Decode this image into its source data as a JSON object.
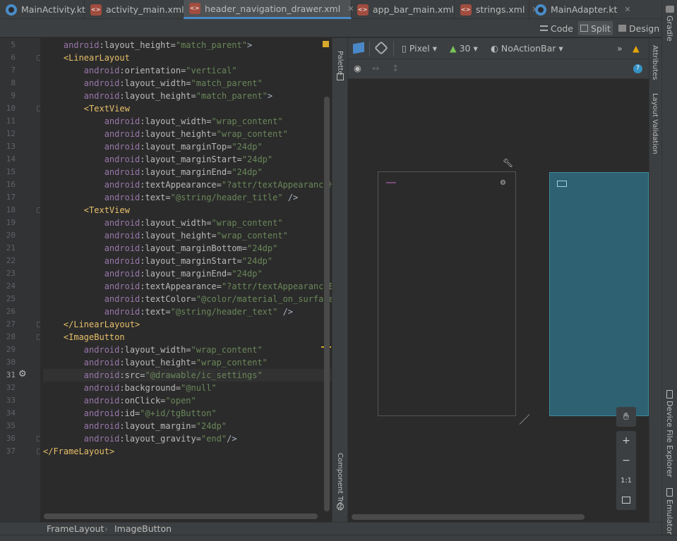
{
  "tabs": [
    {
      "label": "MainActivity.kt",
      "icon": "kotlin-file-icon"
    },
    {
      "label": "activity_main.xml",
      "icon": "xml-file-icon"
    },
    {
      "label": "header_navigation_drawer.xml",
      "icon": "xml-file-icon"
    },
    {
      "label": "app_bar_main.xml",
      "icon": "xml-file-icon"
    },
    {
      "label": "strings.xml",
      "icon": "xml-file-icon"
    },
    {
      "label": "MainAdapter.kt",
      "icon": "kotlin-file-icon"
    }
  ],
  "view_modes": {
    "code": "Code",
    "split": "Split",
    "design": "Design"
  },
  "right_tools": {
    "gradle": "Gradle",
    "device_file_explorer": "Device File Explorer",
    "emulator": "Emulator"
  },
  "side_panels": {
    "palette": "Palette",
    "component_tree": "Component Tree",
    "attributes": "Attributes",
    "layout_validation": "Layout Validation"
  },
  "design_toolbar": {
    "device": "Pixel",
    "api": "30",
    "theme": "NoActionBar"
  },
  "zoom": {
    "plus": "+",
    "minus": "−",
    "one_to_one": "1:1"
  },
  "breadcrumb": [
    "FrameLayout",
    "ImageButton"
  ],
  "code_lines": [
    {
      "n": "5",
      "t": [
        [
          "    ",
          ""
        ],
        [
          "android",
          ""
        ],
        [
          ":layout_height=",
          ""
        ],
        [
          "\"match_parent\"",
          ""
        ],
        [
          ">",
          ""
        ]
      ]
    },
    {
      "n": "6",
      "t": []
    },
    {
      "n": "7",
      "t": []
    },
    {
      "n": "8",
      "t": []
    },
    {
      "n": "9",
      "t": []
    },
    {
      "n": "10",
      "t": []
    },
    {
      "n": "11",
      "t": []
    },
    {
      "n": "12",
      "t": []
    },
    {
      "n": "13",
      "t": []
    },
    {
      "n": "14",
      "t": []
    },
    {
      "n": "15",
      "t": []
    },
    {
      "n": "16",
      "t": []
    },
    {
      "n": "17",
      "t": []
    },
    {
      "n": "18",
      "t": []
    },
    {
      "n": "19",
      "t": []
    },
    {
      "n": "20",
      "t": []
    },
    {
      "n": "21",
      "t": []
    },
    {
      "n": "22",
      "t": []
    },
    {
      "n": "23",
      "t": []
    },
    {
      "n": "24",
      "t": []
    },
    {
      "n": "25",
      "t": []
    },
    {
      "n": "26",
      "t": []
    },
    {
      "n": "27",
      "t": []
    },
    {
      "n": "28",
      "t": []
    },
    {
      "n": "29",
      "t": []
    },
    {
      "n": "30",
      "t": []
    },
    {
      "n": "31",
      "t": []
    },
    {
      "n": "32",
      "t": []
    },
    {
      "n": "33",
      "t": []
    },
    {
      "n": "34",
      "t": []
    },
    {
      "n": "35",
      "t": []
    },
    {
      "n": "36",
      "t": []
    },
    {
      "n": "37",
      "t": []
    }
  ],
  "code": [
    [
      [
        "pl",
        "    "
      ],
      [
        "ns",
        "android"
      ],
      [
        "attr",
        ":layout_height="
      ],
      [
        "str",
        "\"match_parent\""
      ],
      [
        "pl",
        ">"
      ]
    ],
    [
      [
        "pl",
        "    "
      ],
      [
        "tag",
        "<LinearLayout"
      ]
    ],
    [
      [
        "pl",
        "        "
      ],
      [
        "ns",
        "android"
      ],
      [
        "attr",
        ":orientation="
      ],
      [
        "str",
        "\"vertical\""
      ]
    ],
    [
      [
        "pl",
        "        "
      ],
      [
        "ns",
        "android"
      ],
      [
        "attr",
        ":layout_width="
      ],
      [
        "str",
        "\"match_parent\""
      ]
    ],
    [
      [
        "pl",
        "        "
      ],
      [
        "ns",
        "android"
      ],
      [
        "attr",
        ":layout_height="
      ],
      [
        "str",
        "\"match_parent\""
      ],
      [
        "pl",
        ">"
      ]
    ],
    [
      [
        "pl",
        "        "
      ],
      [
        "tag",
        "<TextView"
      ]
    ],
    [
      [
        "pl",
        "            "
      ],
      [
        "ns",
        "android"
      ],
      [
        "attr",
        ":layout_width="
      ],
      [
        "str",
        "\"wrap_content\""
      ]
    ],
    [
      [
        "pl",
        "            "
      ],
      [
        "ns",
        "android"
      ],
      [
        "attr",
        ":layout_height="
      ],
      [
        "str",
        "\"wrap_content\""
      ]
    ],
    [
      [
        "pl",
        "            "
      ],
      [
        "ns",
        "android"
      ],
      [
        "attr",
        ":layout_marginTop="
      ],
      [
        "str",
        "\"24dp\""
      ]
    ],
    [
      [
        "pl",
        "            "
      ],
      [
        "ns",
        "android"
      ],
      [
        "attr",
        ":layout_marginStart="
      ],
      [
        "str",
        "\"24dp\""
      ]
    ],
    [
      [
        "pl",
        "            "
      ],
      [
        "ns",
        "android"
      ],
      [
        "attr",
        ":layout_marginEnd="
      ],
      [
        "str",
        "\"24dp\""
      ]
    ],
    [
      [
        "pl",
        "            "
      ],
      [
        "ns",
        "android"
      ],
      [
        "attr",
        ":textAppearance="
      ],
      [
        "str",
        "\"?attr/textAppearanceHe"
      ]
    ],
    [
      [
        "pl",
        "            "
      ],
      [
        "ns",
        "android"
      ],
      [
        "attr",
        ":text="
      ],
      [
        "str",
        "\"@string/header_title\""
      ],
      [
        "pl",
        " />"
      ]
    ],
    [
      [
        "pl",
        "        "
      ],
      [
        "tag",
        "<TextView"
      ]
    ],
    [
      [
        "pl",
        "            "
      ],
      [
        "ns",
        "android"
      ],
      [
        "attr",
        ":layout_width="
      ],
      [
        "str",
        "\"wrap_content\""
      ]
    ],
    [
      [
        "pl",
        "            "
      ],
      [
        "ns",
        "android"
      ],
      [
        "attr",
        ":layout_height="
      ],
      [
        "str",
        "\"wrap_content\""
      ]
    ],
    [
      [
        "pl",
        "            "
      ],
      [
        "ns",
        "android"
      ],
      [
        "attr",
        ":layout_marginBottom="
      ],
      [
        "str",
        "\"24dp\""
      ]
    ],
    [
      [
        "pl",
        "            "
      ],
      [
        "ns",
        "android"
      ],
      [
        "attr",
        ":layout_marginStart="
      ],
      [
        "str",
        "\"24dp\""
      ]
    ],
    [
      [
        "pl",
        "            "
      ],
      [
        "ns",
        "android"
      ],
      [
        "attr",
        ":layout_marginEnd="
      ],
      [
        "str",
        "\"24dp\""
      ]
    ],
    [
      [
        "pl",
        "            "
      ],
      [
        "ns",
        "android"
      ],
      [
        "attr",
        ":textAppearance="
      ],
      [
        "str",
        "\"?attr/textAppearanceBod"
      ]
    ],
    [
      [
        "pl",
        "            "
      ],
      [
        "ns",
        "android"
      ],
      [
        "attr",
        ":textColor="
      ],
      [
        "str",
        "\"@color/material_on_surface_e"
      ]
    ],
    [
      [
        "pl",
        "            "
      ],
      [
        "ns",
        "android"
      ],
      [
        "attr",
        ":text="
      ],
      [
        "str",
        "\"@string/header_text\""
      ],
      [
        "pl",
        " />"
      ]
    ],
    [
      [
        "pl",
        "    "
      ],
      [
        "tag",
        "</LinearLayout>"
      ]
    ],
    [
      [
        "pl",
        "    "
      ],
      [
        "tag",
        "<ImageButton"
      ]
    ],
    [
      [
        "pl",
        "        "
      ],
      [
        "ns",
        "android"
      ],
      [
        "attr",
        ":layout_width="
      ],
      [
        "str",
        "\"wrap_content\""
      ]
    ],
    [
      [
        "pl",
        "        "
      ],
      [
        "ns",
        "android"
      ],
      [
        "attr",
        ":layout_height="
      ],
      [
        "str",
        "\"wrap_content\""
      ]
    ],
    [
      [
        "pl",
        "        "
      ],
      [
        "ns",
        "android"
      ],
      [
        "attr",
        ":src="
      ],
      [
        "str",
        "\"@drawable/ic_settings\""
      ]
    ],
    [
      [
        "pl",
        "        "
      ],
      [
        "ns",
        "android"
      ],
      [
        "attr",
        ":background="
      ],
      [
        "str",
        "\"@null\""
      ]
    ],
    [
      [
        "pl",
        "        "
      ],
      [
        "ns",
        "android"
      ],
      [
        "attr",
        ":onClick="
      ],
      [
        "str",
        "\"open\""
      ]
    ],
    [
      [
        "pl",
        "        "
      ],
      [
        "ns",
        "android"
      ],
      [
        "attr",
        ":id="
      ],
      [
        "str",
        "\"@+id/tgButton\""
      ]
    ],
    [
      [
        "pl",
        "        "
      ],
      [
        "ns",
        "android"
      ],
      [
        "attr",
        ":layout_margin="
      ],
      [
        "str",
        "\"24dp\""
      ]
    ],
    [
      [
        "pl",
        "        "
      ],
      [
        "ns",
        "android"
      ],
      [
        "attr",
        ":layout_gravity="
      ],
      [
        "str",
        "\"end\""
      ],
      [
        "pl",
        "/>"
      ]
    ],
    [
      [
        "tag",
        "</FrameLayout>"
      ]
    ]
  ],
  "line_numbers": [
    "5",
    "6",
    "7",
    "8",
    "9",
    "10",
    "11",
    "12",
    "13",
    "14",
    "15",
    "16",
    "17",
    "18",
    "19",
    "20",
    "21",
    "22",
    "23",
    "24",
    "25",
    "26",
    "27",
    "28",
    "29",
    "30",
    "31",
    "32",
    "33",
    "34",
    "35",
    "36",
    "37"
  ],
  "current_line": "31",
  "colors": {
    "accent": "#4a88c7",
    "blueprint": "#2e6171",
    "warning": "#e5a50a",
    "help": "#3592c4"
  }
}
